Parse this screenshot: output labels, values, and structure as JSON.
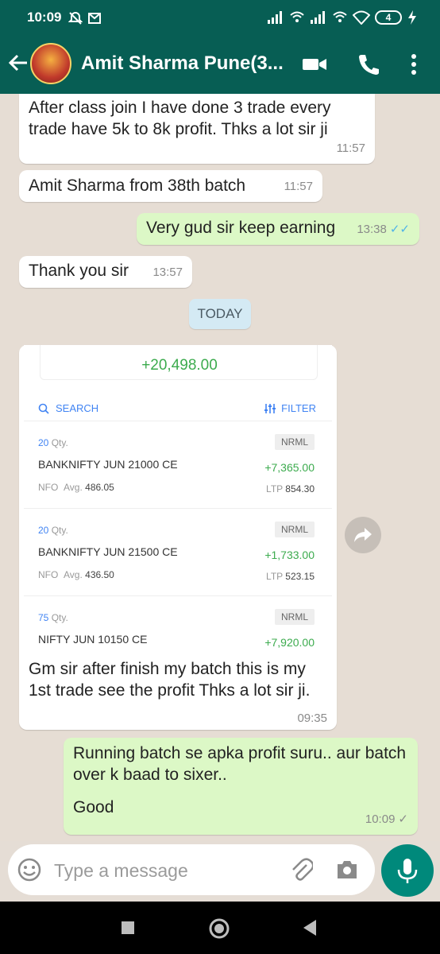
{
  "status_bar": {
    "time": "10:09",
    "battery": "4"
  },
  "header": {
    "contact_name": "Amit Sharma Pune(3..."
  },
  "messages": [
    {
      "text": "After class join I have done 3 trade every trade have 5k to 8k profit. Thks a lot sir ji",
      "time": "11:57"
    },
    {
      "text": "Amit Sharma from 38th batch",
      "time": "11:57"
    },
    {
      "text": "Very gud sir keep earning",
      "time": "13:38"
    },
    {
      "text": "Thank you sir",
      "time": "13:57"
    }
  ],
  "date_divider": "TODAY",
  "image_message": {
    "total_pnl": "+20,498.00",
    "search_label": "SEARCH",
    "filter_label": "FILTER",
    "positions": [
      {
        "qty": "20",
        "qty_unit": "Qty.",
        "instrument": "BANKNIFTY JUN 21000 CE",
        "exchange": "NFO",
        "avg_label": "Avg.",
        "avg": "486.05",
        "product": "NRML",
        "pnl": "+7,365.00",
        "ltp_label": "LTP",
        "ltp": "854.30"
      },
      {
        "qty": "20",
        "qty_unit": "Qty.",
        "instrument": "BANKNIFTY JUN 21500 CE",
        "exchange": "NFO",
        "avg_label": "Avg.",
        "avg": "436.50",
        "product": "NRML",
        "pnl": "+1,733.00",
        "ltp_label": "LTP",
        "ltp": "523.15"
      },
      {
        "qty": "75",
        "qty_unit": "Qty.",
        "instrument": "NIFTY JUN 10150 CE",
        "exchange": "",
        "avg_label": "",
        "avg": "",
        "product": "NRML",
        "pnl": "+7,920.00",
        "ltp_label": "",
        "ltp": ""
      }
    ],
    "caption": "Gm sir after finish my batch this is my 1st trade see the profit Thks a lot sir ji.",
    "time": "09:35"
  },
  "reply": {
    "line1": "Running batch se apka profit suru.. aur batch over k baad to sixer..",
    "line2": "Good",
    "time": "10:09"
  },
  "composer": {
    "placeholder": "Type a message"
  },
  "colors": {
    "header": "#075e54",
    "outgoing_bubble": "#dcf8c6",
    "profit_green": "#3cab4e",
    "link_blue": "#4184f3",
    "mic_button": "#00897b"
  }
}
